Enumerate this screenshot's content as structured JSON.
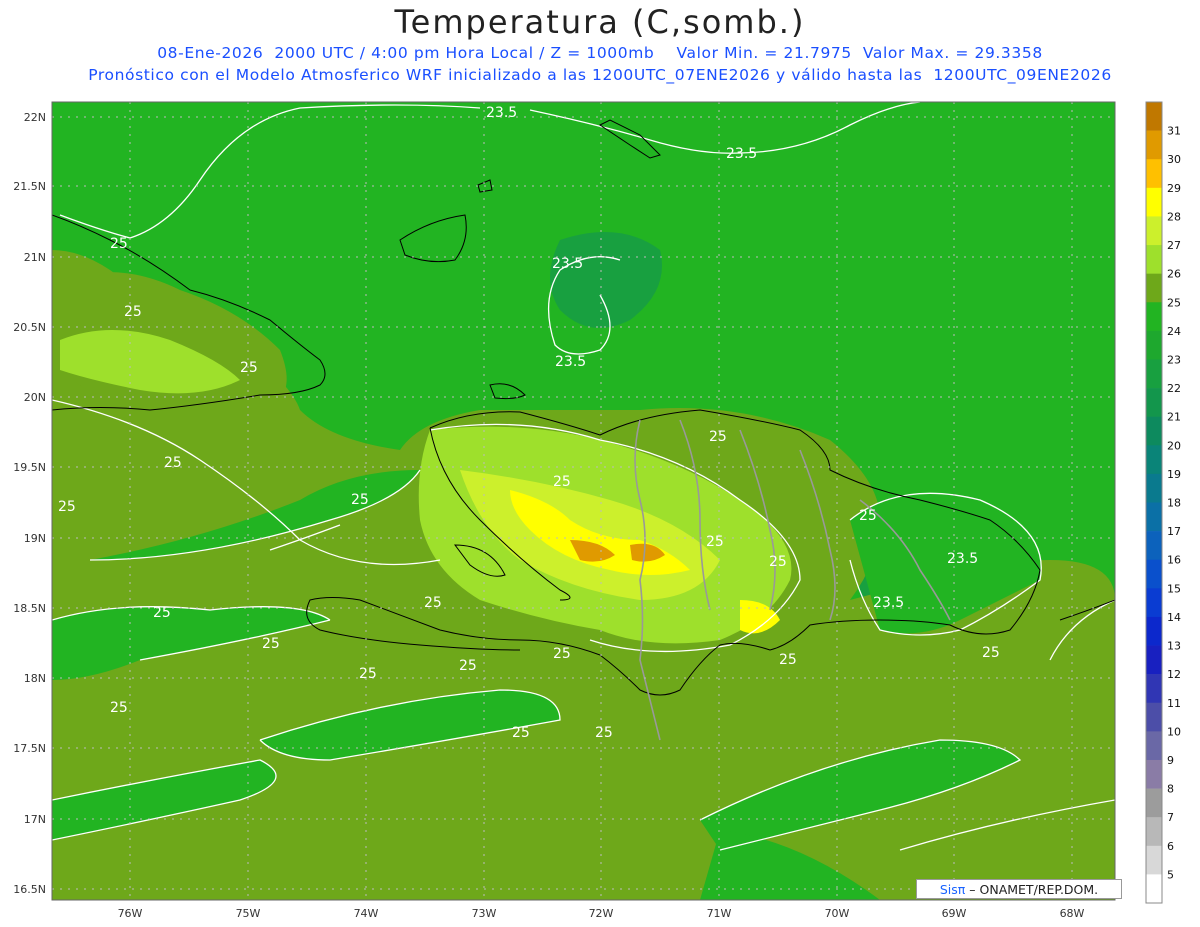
{
  "header": {
    "title": "Temperatura (C,somb.)",
    "subtitle_1": "08-Ene-2026  2000 UTC / 4:00 pm Hora Local / Z = 1000mb    Valor Min. = 21.7975  Valor Max. = 29.3358",
    "subtitle_2": "Pronóstico con el Modelo Atmosferico WRF inicializado a las 1200UTC_07ENE2026 y válido hasta las  1200UTC_09ENE2026"
  },
  "axes": {
    "lat_labels": [
      "22N",
      "21.5N",
      "21N",
      "20.5N",
      "20N",
      "19.5N",
      "19N",
      "18.5N",
      "18N",
      "17.5N",
      "17N",
      "16.5N"
    ],
    "lon_labels": [
      "76W",
      "75W",
      "74W",
      "73W",
      "72W",
      "71W",
      "70W",
      "69W",
      "68W"
    ]
  },
  "colorbar": {
    "levels": [
      "31",
      "30",
      "29",
      "28",
      "27",
      "26",
      "25",
      "24",
      "23",
      "22",
      "21",
      "20",
      "19",
      "18",
      "17",
      "16",
      "15",
      "14",
      "13",
      "12",
      "11",
      "10",
      "9",
      "8",
      "7",
      "6",
      "5"
    ],
    "colors": [
      "#c07800",
      "#e09a00",
      "#ffc000",
      "#ffff00",
      "#ccf02c",
      "#9ee02c",
      "#6ea81a",
      "#22b422",
      "#1ea82e",
      "#18a040",
      "#13964c",
      "#0d8a5e",
      "#0a8478",
      "#0a7a8e",
      "#0b70a6",
      "#0c62bc",
      "#0a50cc",
      "#0a3cd2",
      "#0c28cc",
      "#1820c0",
      "#3036b4",
      "#4c4ea8",
      "#6a68a6",
      "#8a7ca6",
      "#9c9c9c",
      "#b8b8b8",
      "#d8d8d8",
      "#ffffff"
    ]
  },
  "contour_labels": [
    "23.5",
    "23.5",
    "23.5",
    "23.5",
    "25",
    "25",
    "25",
    "25",
    "25",
    "25",
    "25",
    "25",
    "25",
    "25",
    "25",
    "25",
    "25",
    "25",
    "25",
    "25",
    "25",
    "25",
    "25",
    "25",
    "23.5",
    "23.5",
    "25",
    "25"
  ],
  "credit": {
    "brand": "Sisπ",
    "text": "– ONAMET/REP.DOM."
  },
  "colors": {
    "cool_green": "#22b422",
    "warm_green": "#6ea81a",
    "hot_yellow": "#ffff00",
    "hot_orange": "#e09a00"
  }
}
